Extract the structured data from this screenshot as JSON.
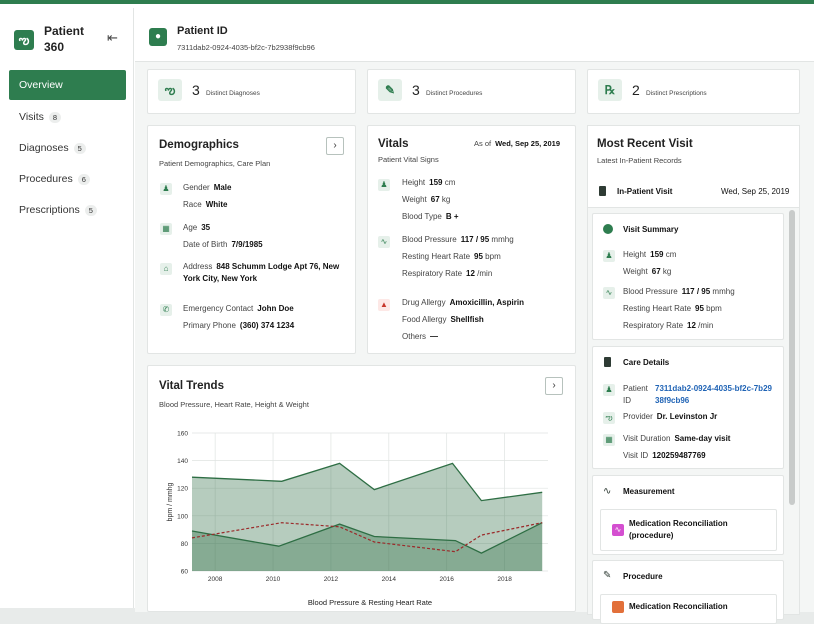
{
  "sidebar": {
    "brand": "Patient 360",
    "items": [
      {
        "label": "Overview",
        "count": ""
      },
      {
        "label": "Visits",
        "count": "8"
      },
      {
        "label": "Diagnoses",
        "count": "5"
      },
      {
        "label": "Procedures",
        "count": "6"
      },
      {
        "label": "Prescriptions",
        "count": "5"
      }
    ]
  },
  "header": {
    "title": "Patient ID",
    "value": "7311dab2-0924-4035-bf2c-7b2938f9cb96"
  },
  "stats": [
    {
      "value": "3",
      "label": "Distinct Diagnoses",
      "icon": "stethoscope-icon"
    },
    {
      "value": "3",
      "label": "Distinct Procedures",
      "icon": "pencil-icon"
    },
    {
      "value": "2",
      "label": "Distinct Prescriptions",
      "icon": "rx-icon"
    }
  ],
  "demographics": {
    "title": "Demographics",
    "subtitle": "Patient Demographics, Care Plan",
    "gender_label": "Gender",
    "gender": "Male",
    "race_label": "Race",
    "race": "White",
    "age_label": "Age",
    "age": "35",
    "dob_label": "Date of Birth",
    "dob": "7/9/1985",
    "address_label": "Address",
    "address": "848 Schumm Lodge Apt 76, New York City, New York",
    "emergency_label": "Emergency Contact",
    "emergency": "John Doe",
    "phone_label": "Primary Phone",
    "phone": "(360) 374 1234"
  },
  "vitals": {
    "title": "Vitals",
    "subtitle": "Patient Vital Signs",
    "asof_label": "As of",
    "asof": "Wed, Sep 25, 2019",
    "height_label": "Height",
    "height": "159",
    "height_unit": "cm",
    "weight_label": "Weight",
    "weight": "67",
    "weight_unit": "kg",
    "blood_type_label": "Blood Type",
    "blood_type": "B +",
    "bp_label": "Blood Pressure",
    "bp": "117 / 95",
    "bp_unit": "mmhg",
    "hr_label": "Resting Heart Rate",
    "hr": "95",
    "hr_unit": "bpm",
    "rr_label": "Respiratory Rate",
    "rr": "12",
    "rr_unit": "/min",
    "drug_allergy_label": "Drug Allergy",
    "drug_allergy": "Amoxicillin, Aspirin",
    "food_allergy_label": "Food Allergy",
    "food_allergy": "Shellfish",
    "others_label": "Others",
    "others": "—"
  },
  "trends": {
    "title": "Vital Trends",
    "subtitle": "Blood Pressure, Heart Rate, Height & Weight"
  },
  "chart_data": {
    "type": "area",
    "title": "Blood Pressure & Resting Heart Rate",
    "xlabel": "",
    "ylabel": "bpm / mmhg",
    "xlim": [
      2007.2,
      2019.5
    ],
    "ylim": [
      60,
      160
    ],
    "yticks": [
      60,
      80,
      100,
      120,
      140,
      160
    ],
    "xticks": [
      2008,
      2010,
      2012,
      2014,
      2016,
      2018
    ],
    "grid": true,
    "series": [
      {
        "kind": "area",
        "color": "#2e6e44",
        "points": [
          [
            2007.2,
            128
          ],
          [
            2010.3,
            125
          ],
          [
            2012.3,
            138
          ],
          [
            2013.5,
            119
          ],
          [
            2016.2,
            138
          ],
          [
            2017.2,
            111
          ],
          [
            2019.3,
            117
          ]
        ]
      },
      {
        "kind": "area",
        "color": "#2e6e44",
        "points": [
          [
            2007.2,
            89
          ],
          [
            2010.2,
            78
          ],
          [
            2012.3,
            94
          ],
          [
            2013.5,
            85
          ],
          [
            2016.3,
            82
          ],
          [
            2017.2,
            73
          ],
          [
            2019.3,
            95
          ]
        ]
      },
      {
        "kind": "line",
        "dashed": true,
        "color": "#9b2a2a",
        "points": [
          [
            2007.2,
            84
          ],
          [
            2010.3,
            95
          ],
          [
            2012.3,
            92
          ],
          [
            2013.5,
            81
          ],
          [
            2016.3,
            74
          ],
          [
            2017.2,
            86
          ],
          [
            2019.3,
            95
          ]
        ]
      }
    ]
  },
  "recent": {
    "title": "Most Recent Visit",
    "subtitle": "Latest In-Patient Records",
    "visit_type": "In-Patient Visit",
    "visit_date": "Wed, Sep 25, 2019",
    "summary_title": "Visit Summary",
    "height_label": "Height",
    "height": "159",
    "height_unit": "cm",
    "weight_label": "Weight",
    "weight": "67",
    "weight_unit": "kg",
    "bp_label": "Blood Pressure",
    "bp": "117 / 95",
    "bp_unit": "mmhg",
    "hr_label": "Resting Heart Rate",
    "hr": "95",
    "hr_unit": "bpm",
    "rr_label": "Respiratory Rate",
    "rr": "12",
    "rr_unit": "/min",
    "care_title": "Care Details",
    "patient_label": "Patient ID",
    "patient_id": "7311dab2-0924-4035-bf2c-7b2938f9cb96",
    "provider_label": "Provider",
    "provider": "Dr. Levinston Jr",
    "duration_label": "Visit Duration",
    "duration": "Same-day visit",
    "visit_id_label": "Visit ID",
    "visit_id": "120259487769",
    "measurement_title": "Measurement",
    "measurement_item": "Medication Reconciliation (procedure)",
    "procedure_title": "Procedure",
    "procedure_item": "Medication Reconciliation"
  }
}
